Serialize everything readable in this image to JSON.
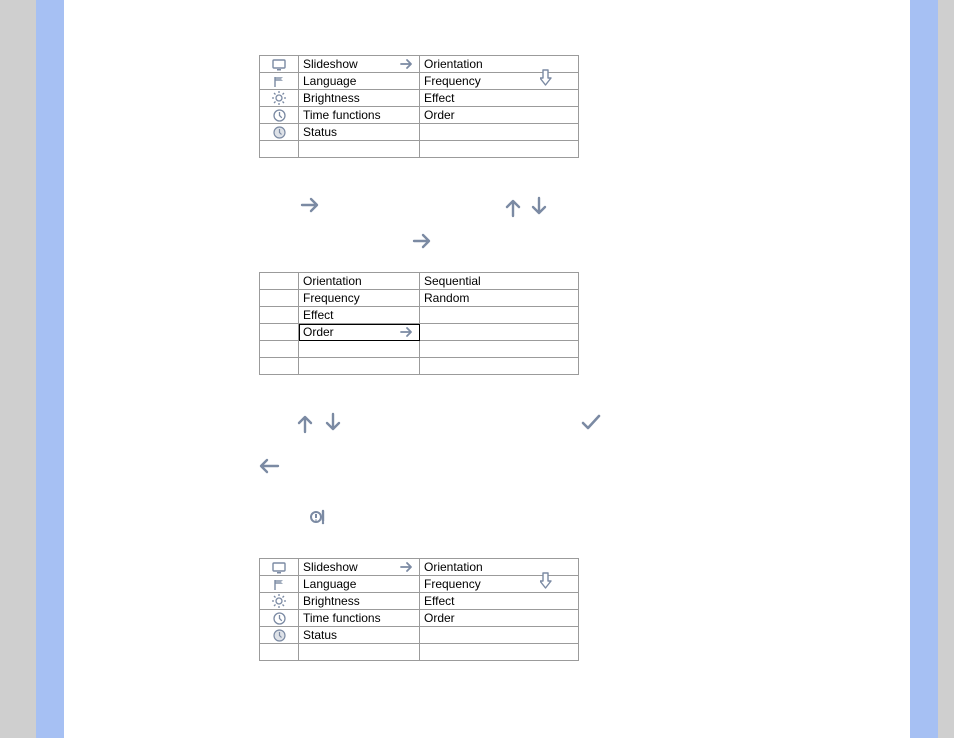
{
  "icons": {
    "slideshow": "monitor-icon",
    "language": "flag-icon",
    "brightness": "sun-icon",
    "time": "clock-face-icon",
    "status": "clock-icon"
  },
  "menu1": {
    "left": [
      {
        "icon": "slideshow",
        "label": "Slideshow",
        "arrow": true
      },
      {
        "icon": "language",
        "label": "Language"
      },
      {
        "icon": "brightness",
        "label": "Brightness"
      },
      {
        "icon": "time",
        "label": "Time functions"
      },
      {
        "icon": "status",
        "label": "Status"
      },
      {
        "label": ""
      }
    ],
    "right": [
      "Orientation",
      "Frequency",
      "Effect",
      "Order",
      "",
      ""
    ]
  },
  "menu2": {
    "left": [
      "Orientation",
      "Frequency",
      "Effect",
      "Order",
      "",
      ""
    ],
    "selectedLeftIndex": 3,
    "right": [
      "Sequential",
      "Random",
      "",
      "",
      "",
      ""
    ]
  },
  "menu3": {
    "left": [
      {
        "icon": "slideshow",
        "label": "Slideshow",
        "arrow": true
      },
      {
        "icon": "language",
        "label": "Language"
      },
      {
        "icon": "brightness",
        "label": "Brightness"
      },
      {
        "icon": "time",
        "label": "Time functions"
      },
      {
        "icon": "status",
        "label": "Status"
      },
      {
        "label": ""
      }
    ],
    "right": [
      "Orientation",
      "Frequency",
      "Effect",
      "Order",
      "",
      ""
    ]
  }
}
